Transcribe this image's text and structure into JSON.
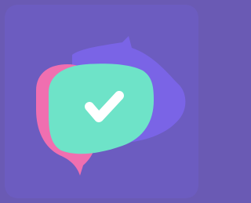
{
  "app_icon": {
    "name": "chat-check-app-icon",
    "colors": {
      "outer_frame": "#6a5ab4",
      "tile_background": "#6c5cc0",
      "left_bubble": "#f06fb0",
      "back_bubble": "#7a64e6",
      "front_bubble": "#6ee3c8",
      "checkmark": "#ffffff"
    },
    "icons": [
      "pink-chat-bubble-icon",
      "purple-chat-bubble-icon",
      "mint-chat-bubble-icon",
      "checkmark-icon"
    ]
  }
}
